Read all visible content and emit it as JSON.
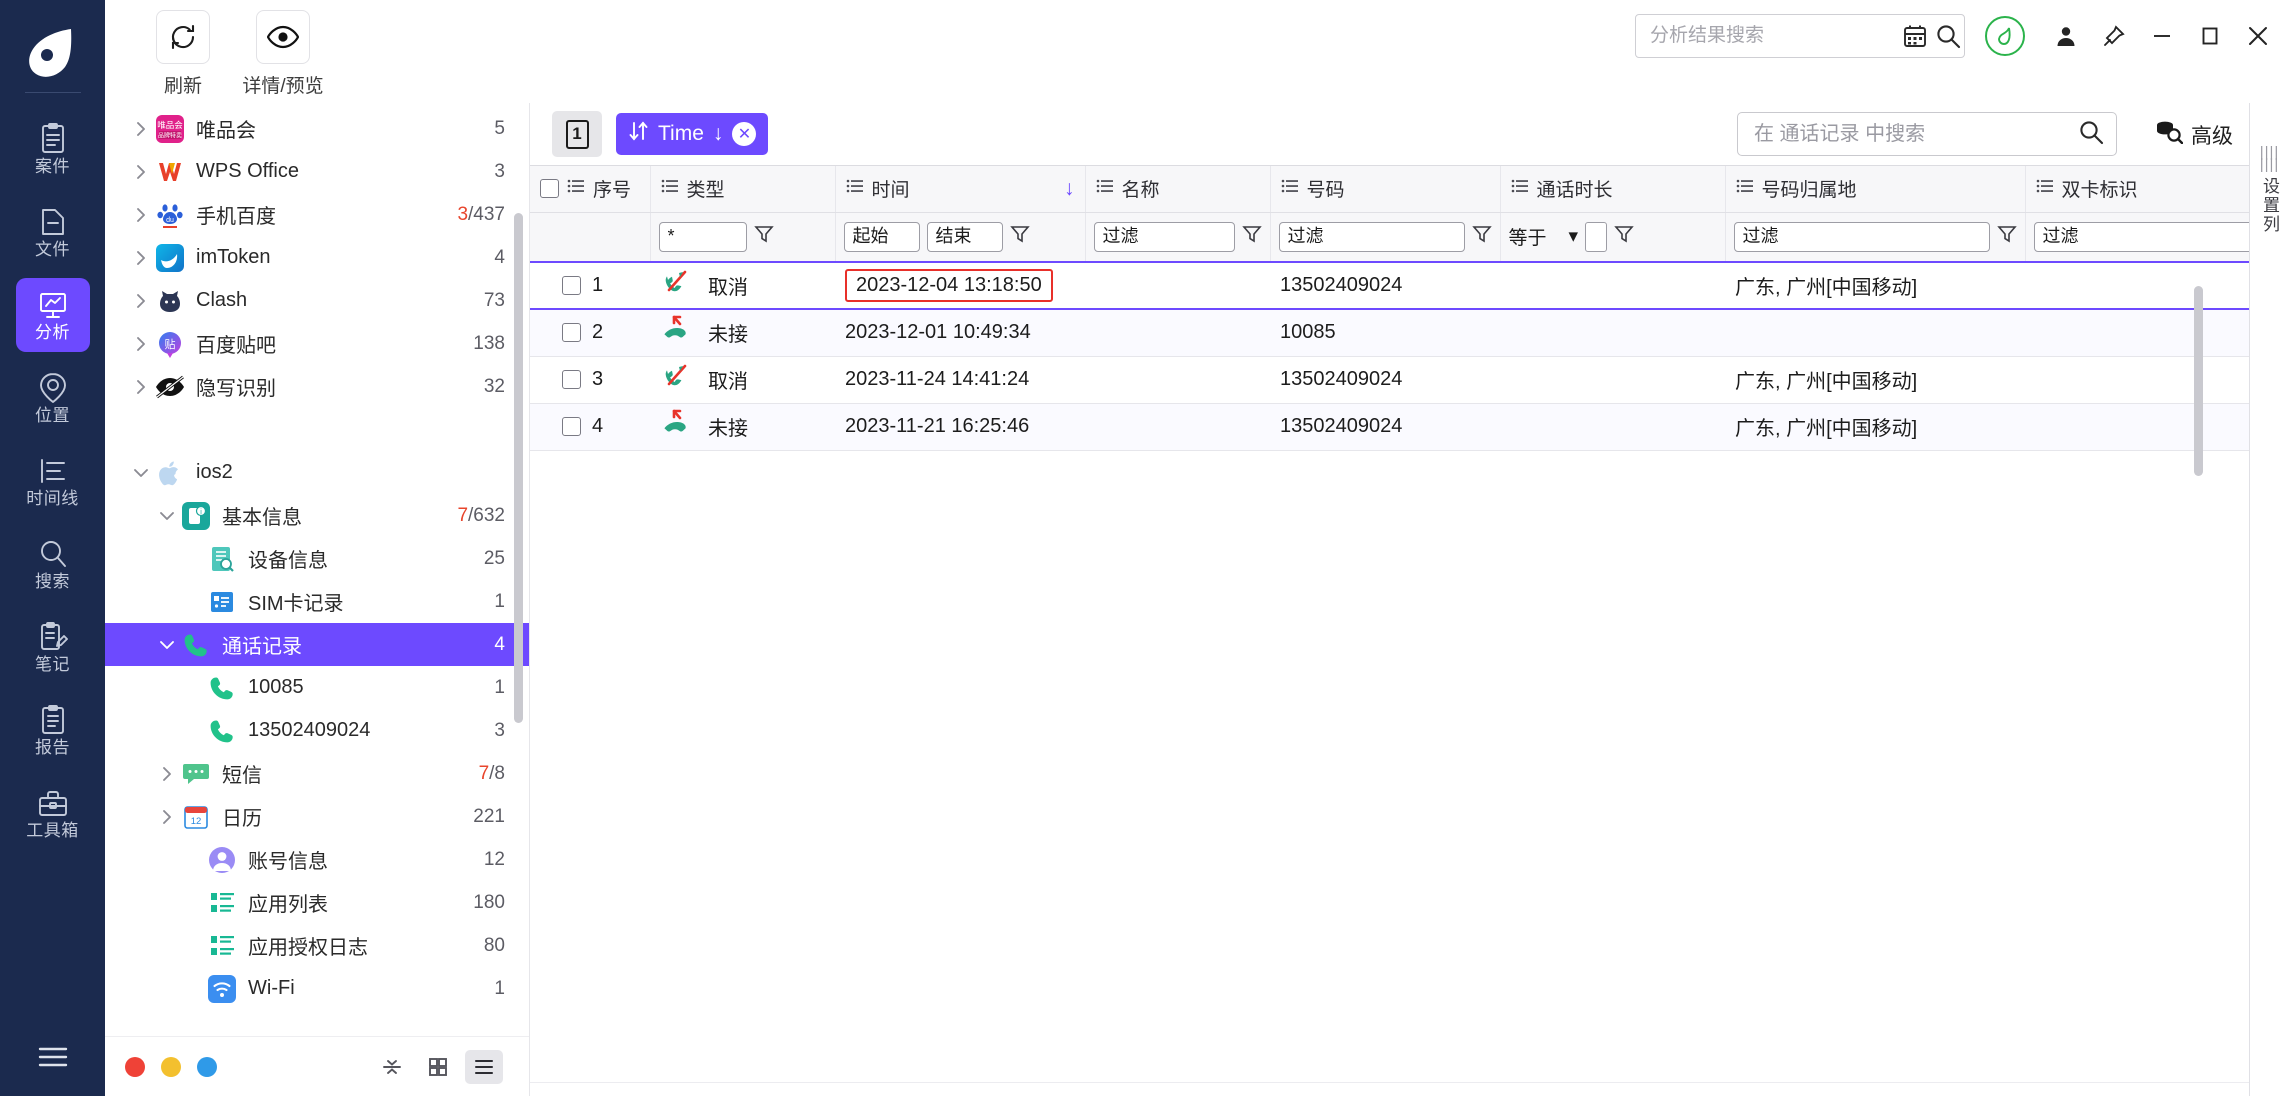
{
  "colors": {
    "rail_bg": "#1b2a4e",
    "accent": "#6d4aff",
    "highlight_red": "#e8302a",
    "green": "#2bb34b",
    "count_hl": "#e8452c"
  },
  "rail": {
    "logo_name": "app-logo",
    "items": [
      {
        "label": "案件",
        "icon": "case-icon",
        "active": false
      },
      {
        "label": "文件",
        "icon": "file-icon",
        "active": false
      },
      {
        "label": "分析",
        "icon": "analysis-icon",
        "active": true
      },
      {
        "label": "位置",
        "icon": "location-icon",
        "active": false
      },
      {
        "label": "时间线",
        "icon": "timeline-icon",
        "active": false
      },
      {
        "label": "搜索",
        "icon": "search-icon",
        "active": false
      },
      {
        "label": "笔记",
        "icon": "notes-icon",
        "active": false
      },
      {
        "label": "报告",
        "icon": "report-icon",
        "active": false
      },
      {
        "label": "工具箱",
        "icon": "toolbox-icon",
        "active": false
      }
    ],
    "menu_icon": "hamburger-menu-icon"
  },
  "topbar": {
    "tools": [
      {
        "label": "刷新",
        "icon": "refresh-icon"
      },
      {
        "label": "详情/预览",
        "icon": "eye-icon"
      }
    ],
    "search": {
      "placeholder": "分析结果搜索",
      "value": "",
      "calendar_icon": "calendar-icon",
      "search_icon": "search-icon"
    },
    "notify_icon": "leaf-badge-icon",
    "window_buttons": [
      {
        "icon": "user-icon",
        "glyph": "👤"
      },
      {
        "icon": "pin-icon",
        "glyph": "📌"
      },
      {
        "icon": "minimize-icon",
        "glyph": "–"
      },
      {
        "icon": "maximize-icon",
        "glyph": "□"
      },
      {
        "icon": "close-icon",
        "glyph": "✕"
      }
    ]
  },
  "tree": {
    "nodes": [
      {
        "label": "唯品会",
        "count": "5",
        "count_hl": "",
        "icon": "vip-app-icon",
        "indent": 0,
        "arrow": "right",
        "selected": false
      },
      {
        "label": "WPS Office",
        "count": "3",
        "count_hl": "",
        "icon": "wps-app-icon",
        "indent": 0,
        "arrow": "right",
        "selected": false
      },
      {
        "label": "手机百度",
        "count": "/437",
        "count_hl": "3",
        "icon": "baidu-app-icon",
        "indent": 0,
        "arrow": "right",
        "selected": false
      },
      {
        "label": "imToken",
        "count": "4",
        "count_hl": "",
        "icon": "imtoken-app-icon",
        "indent": 0,
        "arrow": "right",
        "selected": false
      },
      {
        "label": "Clash",
        "count": "73",
        "count_hl": "",
        "icon": "clash-app-icon",
        "indent": 0,
        "arrow": "right",
        "selected": false
      },
      {
        "label": "百度贴吧",
        "count": "138",
        "count_hl": "",
        "icon": "tieba-app-icon",
        "indent": 0,
        "arrow": "right",
        "selected": false
      },
      {
        "label": "隐写识别",
        "count": "32",
        "count_hl": "",
        "icon": "steganography-icon",
        "indent": 0,
        "arrow": "right",
        "selected": false
      },
      {
        "label": "",
        "count": "",
        "count_hl": "",
        "icon": "spacer",
        "indent": 0,
        "arrow": "none",
        "selected": false
      },
      {
        "label": "ios2",
        "count": "",
        "count_hl": "",
        "icon": "apple-icon",
        "indent": 0,
        "arrow": "down",
        "selected": false
      },
      {
        "label": "基本信息",
        "count": "/632",
        "count_hl": "7",
        "icon": "device-info-icon",
        "indent": 1,
        "arrow": "down",
        "selected": false
      },
      {
        "label": "设备信息",
        "count": "25",
        "count_hl": "",
        "icon": "device-detail-icon",
        "indent": 2,
        "arrow": "none",
        "selected": false
      },
      {
        "label": "SIM卡记录",
        "count": "1",
        "count_hl": "",
        "icon": "sim-card-icon",
        "indent": 2,
        "arrow": "none",
        "selected": false
      },
      {
        "label": "通话记录",
        "count": "4",
        "count_hl": "",
        "icon": "phone-icon",
        "indent": 1,
        "arrow": "down",
        "selected": true
      },
      {
        "label": "10085",
        "count": "1",
        "count_hl": "",
        "icon": "phone-icon",
        "indent": 2,
        "arrow": "none",
        "selected": false
      },
      {
        "label": "13502409024",
        "count": "3",
        "count_hl": "",
        "icon": "phone-icon",
        "indent": 2,
        "arrow": "none",
        "selected": false
      },
      {
        "label": "短信",
        "count": "/8",
        "count_hl": "7",
        "icon": "sms-icon",
        "indent": 1,
        "arrow": "right",
        "selected": false
      },
      {
        "label": "日历",
        "count": "221",
        "count_hl": "",
        "icon": "calendar-icon",
        "indent": 1,
        "arrow": "right",
        "selected": false
      },
      {
        "label": "账号信息",
        "count": "12",
        "count_hl": "",
        "icon": "account-icon",
        "indent": 2,
        "arrow": "none",
        "selected": false
      },
      {
        "label": "应用列表",
        "count": "180",
        "count_hl": "",
        "icon": "app-list-icon",
        "indent": 2,
        "arrow": "none",
        "selected": false
      },
      {
        "label": "应用授权日志",
        "count": "80",
        "count_hl": "",
        "icon": "app-list-icon",
        "indent": 2,
        "arrow": "none",
        "selected": false
      },
      {
        "label": "Wi-Fi",
        "count": "1",
        "count_hl": "",
        "icon": "wifi-icon",
        "indent": 2,
        "arrow": "none",
        "selected": false
      }
    ],
    "footer": {
      "dots": [
        {
          "name": "red-dot",
          "color": "#ef4237"
        },
        {
          "name": "yellow-dot",
          "color": "#f3c02e"
        },
        {
          "name": "blue-dot",
          "color": "#2f9ae8"
        }
      ],
      "views": [
        {
          "name": "collapse-view-button",
          "icon": "collapse-icon",
          "active": false
        },
        {
          "name": "grid-view-button",
          "icon": "grid-icon",
          "active": false
        },
        {
          "name": "list-view-button",
          "icon": "list-icon",
          "active": true
        }
      ]
    }
  },
  "main": {
    "page_chip": "1",
    "sort_chip": {
      "label": "Time",
      "direction": "↓",
      "sort_icon": "sort-updown-icon",
      "close_icon": "close-icon"
    },
    "search": {
      "placeholder": "在 通话记录 中搜索",
      "value": "",
      "search_icon": "search-icon"
    },
    "advanced": {
      "label": "高级",
      "icon": "advanced-search-icon"
    },
    "settings_rail": {
      "label": "设置列",
      "grip_icon": "grip-dots-icon"
    }
  },
  "table": {
    "columns": [
      {
        "key": "idx",
        "header": "序号",
        "menu_icon": "column-menu-icon"
      },
      {
        "key": "type",
        "header": "类型",
        "menu_icon": "column-menu-icon"
      },
      {
        "key": "time",
        "header": "时间",
        "menu_icon": "column-menu-icon",
        "sorted": "desc"
      },
      {
        "key": "name",
        "header": "名称",
        "menu_icon": "column-menu-icon"
      },
      {
        "key": "number",
        "header": "号码",
        "menu_icon": "column-menu-icon"
      },
      {
        "key": "duration",
        "header": "通话时长",
        "menu_icon": "column-menu-icon"
      },
      {
        "key": "region",
        "header": "号码归属地",
        "menu_icon": "column-menu-icon"
      },
      {
        "key": "sim",
        "header": "双卡标识",
        "menu_icon": "column-menu-icon"
      }
    ],
    "filters": {
      "type_value": "*",
      "time_start_placeholder": "起始",
      "time_end_placeholder": "结束",
      "name_placeholder": "过滤",
      "number_placeholder": "过滤",
      "duration_operator": "等于",
      "duration_value": "",
      "region_placeholder": "过滤",
      "sim_placeholder": "过滤",
      "funnel_icon": "funnel-filter-icon",
      "dropdown_icon": "chevron-down-icon"
    },
    "select_all_checkbox": false,
    "rows": [
      {
        "idx": "1",
        "checked": false,
        "type": "取消",
        "type_icon": "call-cancelled-icon",
        "time": "2023-12-04 13:18:50",
        "time_highlighted": true,
        "name": "",
        "number": "13502409024",
        "duration": "",
        "region": "广东, 广州[中国移动]",
        "sim": "",
        "focused": true
      },
      {
        "idx": "2",
        "checked": false,
        "type": "未接",
        "type_icon": "call-missed-icon",
        "time": "2023-12-01 10:49:34",
        "time_highlighted": false,
        "name": "",
        "number": "10085",
        "duration": "",
        "region": "",
        "sim": "",
        "focused": false
      },
      {
        "idx": "3",
        "checked": false,
        "type": "取消",
        "type_icon": "call-cancelled-icon",
        "time": "2023-11-24 14:41:24",
        "time_highlighted": false,
        "name": "",
        "number": "13502409024",
        "duration": "",
        "region": "广东, 广州[中国移动]",
        "sim": "",
        "focused": false
      },
      {
        "idx": "4",
        "checked": false,
        "type": "未接",
        "type_icon": "call-missed-icon",
        "time": "2023-11-21 16:25:46",
        "time_highlighted": false,
        "name": "",
        "number": "13502409024",
        "duration": "",
        "region": "广东, 广州[中国移动]",
        "sim": "",
        "focused": false
      }
    ]
  }
}
